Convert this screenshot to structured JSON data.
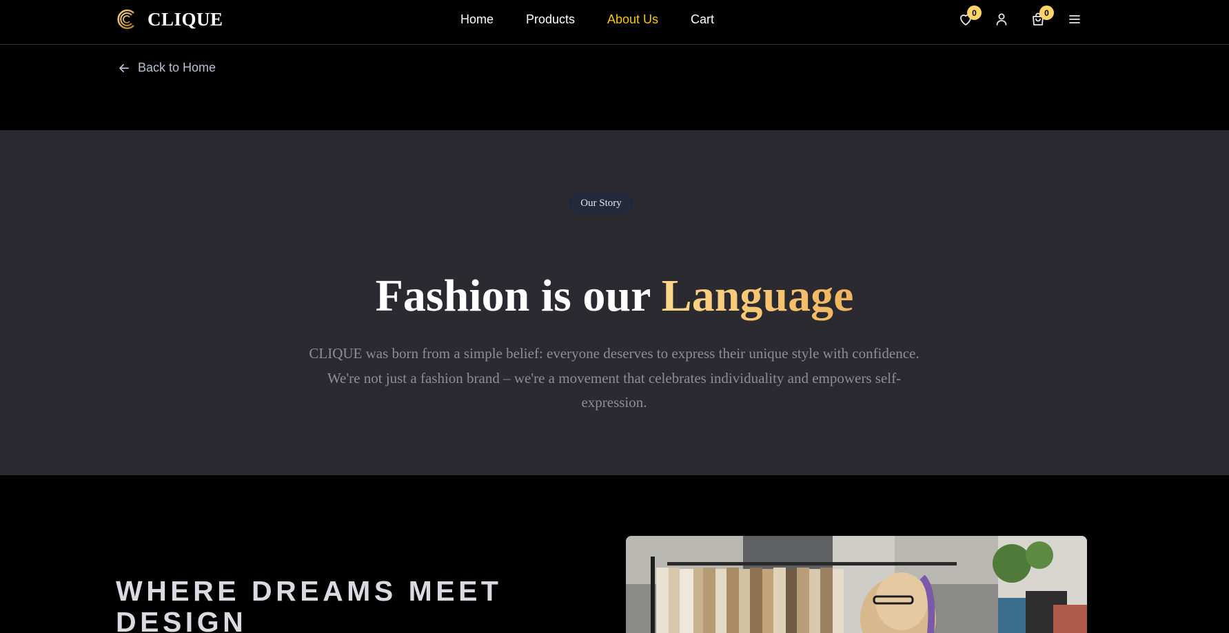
{
  "brand": {
    "name": "CLIQUE",
    "logo_icon": "clique-c-logo-icon",
    "accent": "#f5c518"
  },
  "nav": {
    "items": [
      {
        "label": "Home",
        "active": false
      },
      {
        "label": "Products",
        "active": false
      },
      {
        "label": "About Us",
        "active": true
      },
      {
        "label": "Cart",
        "active": false
      }
    ]
  },
  "header_actions": {
    "wishlist": {
      "icon": "heart-icon",
      "count": "0"
    },
    "account": {
      "icon": "user-icon"
    },
    "cart": {
      "icon": "shopping-bag-icon",
      "count": "0"
    },
    "menu": {
      "icon": "hamburger-menu-icon"
    }
  },
  "back_link": {
    "label": "Back to Home",
    "icon": "arrow-left-icon"
  },
  "story": {
    "badge": "Our Story",
    "headline_plain": "Fashion is our ",
    "headline_accent": "Language",
    "body": "CLIQUE was born from a simple belief: everyone deserves to express their unique style with confidence. We're not just a fashion brand – we're a movement that celebrates individuality and empowers self-expression."
  },
  "dreams": {
    "heading": "WHERE DREAMS MEET DESIGN"
  },
  "colors": {
    "page_bg": "#000000",
    "story_bg": "#2b2a30",
    "accent_gold": "#fcd36b",
    "headline_gradient_start": "#fdd889",
    "headline_gradient_end": "#f0b45f"
  }
}
